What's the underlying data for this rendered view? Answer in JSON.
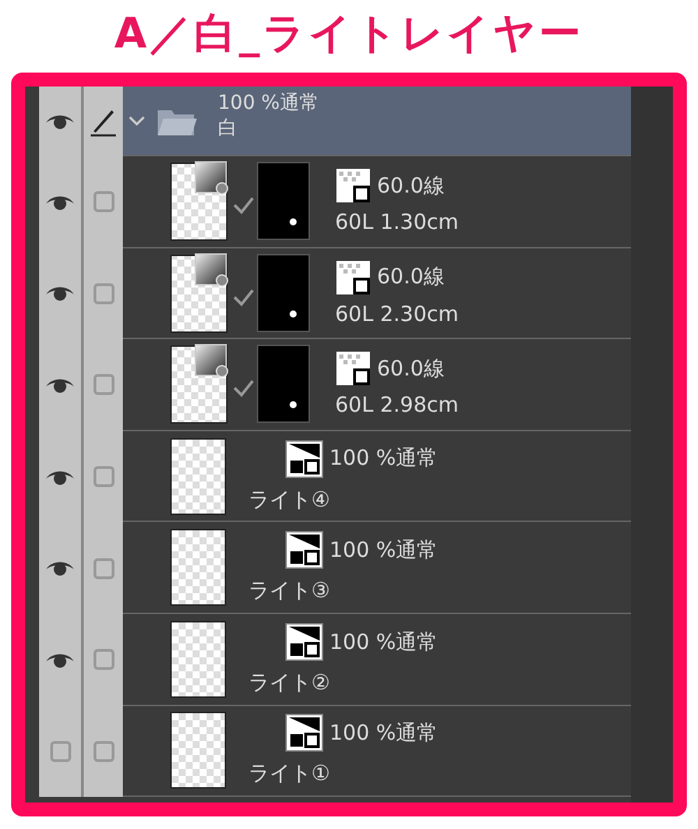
{
  "title": "A／白_ライトレイヤー",
  "layers": [
    {
      "kind": "folder",
      "visible": true,
      "selected": true,
      "expanded": true,
      "mode": "100 %通常",
      "name": "白"
    },
    {
      "kind": "tone",
      "visible": true,
      "selected": false,
      "mode": "60.0線",
      "name": "60L 1.30cm"
    },
    {
      "kind": "tone",
      "visible": true,
      "selected": false,
      "mode": "60.0線",
      "name": "60L 2.30cm"
    },
    {
      "kind": "tone",
      "visible": true,
      "selected": false,
      "mode": "60.0線",
      "name": "60L 2.98cm"
    },
    {
      "kind": "raster",
      "visible": true,
      "selected": false,
      "mode": "100 %通常",
      "name": "ライト④"
    },
    {
      "kind": "raster",
      "visible": true,
      "selected": false,
      "mode": "100 %通常",
      "name": "ライト③"
    },
    {
      "kind": "raster",
      "visible": true,
      "selected": false,
      "mode": "100 %通常",
      "name": "ライト②"
    },
    {
      "kind": "raster",
      "visible": false,
      "selected": false,
      "mode": "100 %通常",
      "name": "ライト①"
    }
  ]
}
